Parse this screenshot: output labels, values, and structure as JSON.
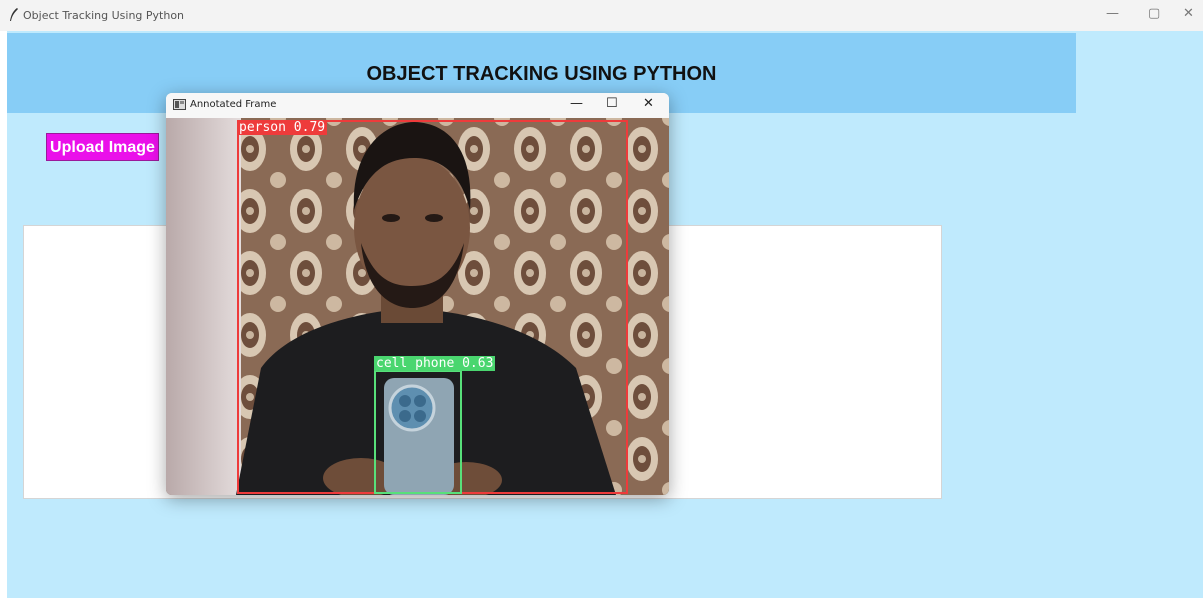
{
  "main_window": {
    "title": "Object Tracking Using Python",
    "controls": {
      "minimize": "—",
      "maximize": "▢",
      "close": "✕"
    },
    "icon": "feather-icon"
  },
  "banner": {
    "title": "OBJECT TRACKING USING PYTHON"
  },
  "upload_button": {
    "label": "Upload Image"
  },
  "popup": {
    "title": "Annotated Frame",
    "controls": {
      "minimize": "—",
      "maximize": "☐",
      "close": "✕"
    },
    "icon": "window-icon"
  },
  "detections": [
    {
      "label": "person 0.79",
      "color": "#ee3b3b"
    },
    {
      "label": "cell phone 0.63",
      "color": "#4ad66f"
    }
  ],
  "colors": {
    "background": "#bfeafd",
    "banner": "#87cdf6",
    "upload_button": "#ea10ea"
  }
}
